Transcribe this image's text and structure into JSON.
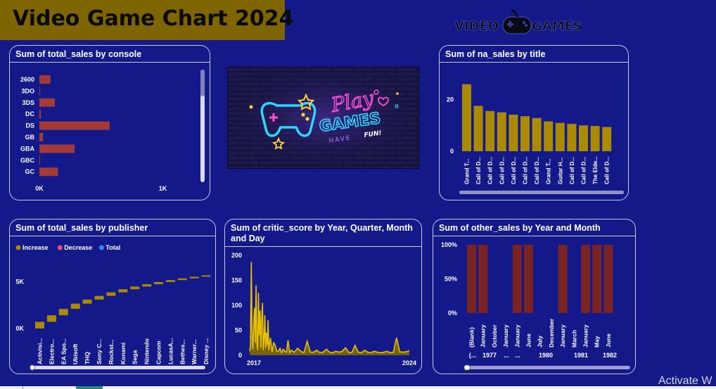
{
  "report_title": "Video Game Chart 2024",
  "logo": {
    "text": "VIDEO GAMES",
    "icon": "gamepad-icon"
  },
  "banner_image": {
    "icon": "neon-play-games-image",
    "line1": "Play",
    "line2": "GAMES",
    "line3": "HAVE",
    "line4": "FUN!"
  },
  "watermark": "Activate W",
  "colors": {
    "background": "#14198a",
    "title_bg": "#7f6500",
    "gold": "#a98a00",
    "red": "#a33a3a",
    "maroon": "#7a2323",
    "critic": "#e8c000"
  },
  "chart_data": [
    {
      "id": "console",
      "type": "bar",
      "orientation": "horizontal",
      "title": "Sum of total_sales by console",
      "categories": [
        "2600",
        "3DO",
        "3DS",
        "DC",
        "DS",
        "GB",
        "GBA",
        "GBC",
        "GC"
      ],
      "values": [
        90,
        0.1,
        125,
        12,
        570,
        30,
        285,
        3,
        150
      ],
      "xticks": [
        "0K",
        "1K"
      ],
      "xlim": [
        0,
        1100
      ]
    },
    {
      "id": "na-title",
      "type": "bar",
      "title": "Sum of na_sales by title",
      "categories": [
        "Grand T...",
        "Call of D...",
        "Call of D...",
        "Call of D...",
        "Call of D...",
        "Call of D...",
        "Call of D...",
        "Grand T...",
        "Guitar H...",
        "Call of D...",
        "Call of D...",
        "The Elde...",
        "Call of D..."
      ],
      "values": [
        26.0,
        17.6,
        15.6,
        15.1,
        14.2,
        13.6,
        12.9,
        11.6,
        11.0,
        10.6,
        10.0,
        9.8,
        9.4
      ],
      "yticks": [
        "0",
        "20"
      ],
      "ylim": [
        0,
        30
      ]
    },
    {
      "id": "publisher",
      "type": "waterfall",
      "title": "Sum of total_sales by publisher",
      "legend": [
        {
          "name": "Increase",
          "color": "#a98a00"
        },
        {
          "name": "Decrease",
          "color": "#e0566b"
        },
        {
          "name": "Total",
          "color": "#2f8cff"
        }
      ],
      "categories": [
        "Activisi...",
        "Electro...",
        "EA Spo...",
        "Ubisoft",
        "THQ",
        "Sony C...",
        "Rockst...",
        "Konami",
        "Sega",
        "Nintendo",
        "Capcom",
        "LucasA...",
        "Bethes...",
        "Warner...",
        "Disney ..."
      ],
      "increments": [
        720,
        700,
        680,
        560,
        430,
        400,
        380,
        330,
        290,
        250,
        230,
        210,
        190,
        170,
        150
      ],
      "yticks": [
        "0K",
        "5K"
      ],
      "ylim": [
        0,
        7000
      ]
    },
    {
      "id": "critic",
      "type": "area",
      "title": "Sum of critic_score by Year, Quarter, Month and Day",
      "xticks": [
        "2017",
        "2024"
      ],
      "yticks": [
        "0",
        "50",
        "100",
        "150",
        "200"
      ],
      "ylim": [
        0,
        200
      ],
      "x": [
        0,
        0.5,
        1,
        1.5,
        2,
        2.5,
        3,
        3.5,
        4,
        4.5,
        5,
        5.5,
        6,
        6.5,
        7,
        7.5,
        8,
        8.5,
        9,
        9.5,
        10,
        10.5,
        11,
        11.5,
        12,
        13,
        14,
        15,
        16,
        17,
        18,
        19,
        20,
        21,
        22,
        23,
        24,
        25,
        26,
        27,
        28,
        30,
        32,
        34,
        36,
        38,
        40,
        42,
        44,
        46,
        48,
        50,
        52,
        54,
        56,
        58,
        60,
        62,
        64,
        66,
        68,
        70,
        72,
        74,
        76,
        78,
        80,
        82,
        84,
        86,
        88,
        90,
        92,
        94,
        96,
        98,
        100
      ],
      "values": [
        8,
        20,
        187,
        40,
        12,
        60,
        95,
        25,
        140,
        30,
        10,
        125,
        40,
        90,
        15,
        70,
        105,
        10,
        30,
        80,
        15,
        45,
        20,
        70,
        10,
        35,
        6,
        25,
        20,
        8,
        8,
        14,
        5,
        12,
        8,
        6,
        30,
        5,
        10,
        8,
        6,
        14,
        8,
        5,
        28,
        6,
        6,
        10,
        5,
        6,
        12,
        6,
        5,
        8,
        6,
        8,
        15,
        6,
        5,
        20,
        6,
        5,
        10,
        6,
        5,
        8,
        6,
        5,
        6,
        8,
        5,
        6,
        35,
        7,
        6,
        7,
        9
      ]
    },
    {
      "id": "other-sales",
      "type": "bar",
      "title": "Sum of other_sales by Year and Month",
      "categories": [
        "(Blank)",
        "January",
        "October",
        "January",
        "January",
        "June",
        "July",
        "December",
        "January",
        "March",
        "January",
        "May",
        "June"
      ],
      "values": [
        100,
        100,
        0,
        0,
        100,
        100,
        0,
        0,
        100,
        0,
        100,
        100,
        100
      ],
      "yticks": [
        "0%",
        "50%",
        "100%"
      ],
      "ylim": [
        0,
        100
      ],
      "groups": [
        "(...",
        "1977",
        "...",
        "...",
        "1980",
        "1981",
        "1982"
      ]
    }
  ]
}
